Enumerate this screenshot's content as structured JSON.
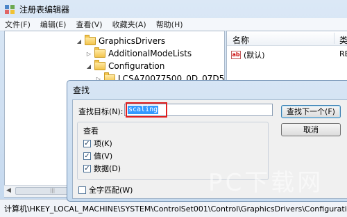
{
  "window": {
    "title": "注册表编辑器"
  },
  "menu": [
    "文件(F)",
    "编辑(E)",
    "查看(V)",
    "收藏夹(A)",
    "帮助(H)"
  ],
  "tree": [
    {
      "label": "GraphicsDrivers",
      "expanded": true
    },
    {
      "label": "AdditionalModeLists",
      "expanded": false
    },
    {
      "label": "Configuration",
      "expanded": true
    },
    {
      "label": "LCSA70077500_0D_07D5"
    }
  ],
  "right_pane": {
    "col_name": "名称",
    "col_type": "类",
    "values": [
      {
        "name": "(默认)",
        "type": "RE"
      }
    ]
  },
  "dialog": {
    "title": "查找",
    "find_label": "查找目标(N):",
    "find_value": "scaling",
    "find_next": "查找下一个(F)",
    "cancel": "取消",
    "look_at": "查看",
    "options": [
      {
        "label": "项(K)",
        "checked": true
      },
      {
        "label": "值(V)",
        "checked": true
      },
      {
        "label": "数据(D)",
        "checked": true
      }
    ],
    "match_whole": {
      "label": "全字匹配(W)",
      "checked": false
    }
  },
  "status": "计算机\\HKEY_LOCAL_MACHINE\\SYSTEM\\ControlSet001\\Control\\GraphicsDrivers\\Configuratio",
  "watermark": "PC下载网"
}
